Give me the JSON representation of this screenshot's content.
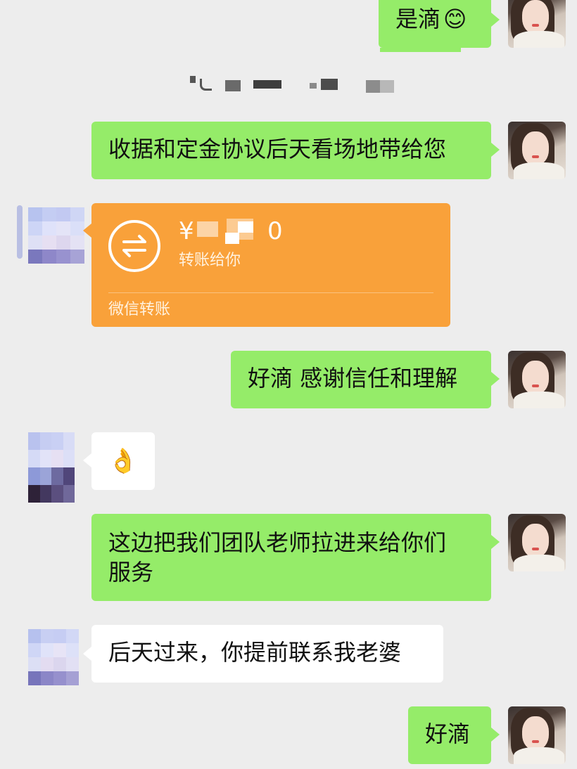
{
  "messages": {
    "m1": {
      "text": "是滴",
      "emoji": "😊"
    },
    "m2": {
      "text": "收据和定金协议后天看场地带给您"
    },
    "transfer": {
      "amount_visible": "¥",
      "amount_suffix": "0",
      "subtitle": "转账给你",
      "footer": "微信转账"
    },
    "m4": {
      "text": "好滴 感谢信任和理解"
    },
    "m5": {
      "emoji": "👌"
    },
    "m6": {
      "line1": "这边把我们团队老师拉进来给你们",
      "line2": "服务"
    },
    "m7": {
      "text": "后天过来，你提前联系我老婆"
    },
    "m8": {
      "text": "好滴"
    }
  },
  "icons": {
    "transfer": "transfer-arrows-icon"
  },
  "colors": {
    "background": "#ededed",
    "my_bubble": "#95ec69",
    "other_bubble": "#ffffff",
    "transfer_card": "#f9a13a"
  }
}
